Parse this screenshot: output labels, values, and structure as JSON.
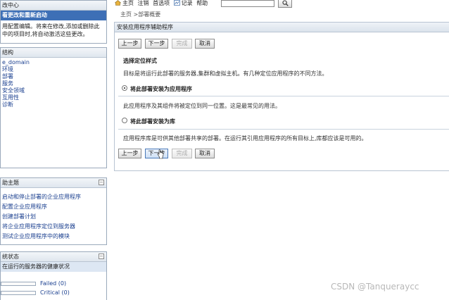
{
  "left": {
    "change_center": {
      "title": "改中心",
      "button": "看更改和重新启动",
      "desc_line1": "用配置编辑。将来在修改,添加或删除此",
      "desc_line2": "中的项目时,将自动激活这些更改。"
    },
    "domain_structure": {
      "title": "结构",
      "items": [
        "e_domain",
        "环境",
        "部署",
        "服务",
        "安全领域",
        "互用性",
        "诊断"
      ]
    },
    "help_topics": {
      "title": "助主题",
      "collapse": "⊟",
      "items": [
        "启动和停止部署的企业应用程序",
        "配置企业应用程序",
        "创建部署计划",
        "将企业应用程序定位到服务器",
        "测试企业应用程序中的模块"
      ]
    },
    "system_status": {
      "title": "统状态",
      "collapse": "⊟",
      "subtitle": "在运行的服务器的健康状况",
      "rows": [
        {
          "label": "Failed (0)"
        },
        {
          "label": "Critical (0)"
        }
      ]
    }
  },
  "topnav": {
    "items": [
      "主页",
      "注销",
      "首选项",
      "记录",
      "帮助"
    ],
    "search_placeholder": "",
    "search_button": "🔍"
  },
  "breadcrumb": "主页 >部署概要",
  "main": {
    "title": "安装应用程序辅助程序",
    "buttons": {
      "back": "上一步",
      "next": "下一步",
      "finish": "完成",
      "cancel": "取消"
    },
    "section_title": "选择定位样式",
    "section_desc": "目标是将运行此部署的服务器,集群和虚拟主机。有几种定位应用程序的不同方法。",
    "option1_label": "将此部署安装为应用程序",
    "option1_desc": "此应用程序及其组件将被定位到同一位置。这是最常见的用法。",
    "option2_label": "将此部署安装为库",
    "option2_desc": "应用程序库是可供其他部署共享的部署。在运行其引用应用程序的所有目标上,库都应该是可用的。"
  },
  "watermark": "CSDN @Tanqueraycc"
}
